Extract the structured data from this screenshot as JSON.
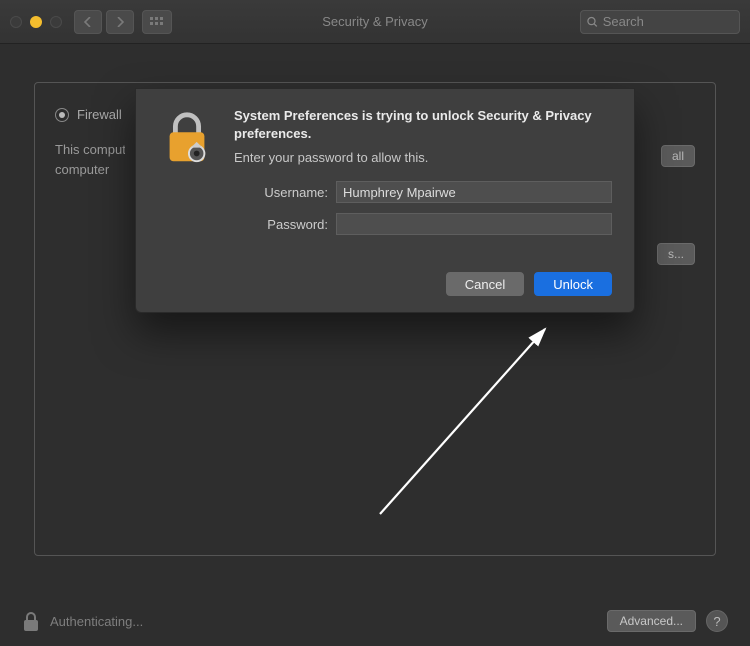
{
  "window": {
    "title": "Security & Privacy",
    "search_placeholder": "Search"
  },
  "tabs": {
    "selected_label": "Firewall"
  },
  "panel": {
    "info_line1": "This computer's firewall is currently turned on.",
    "info_line2": "computer",
    "btn1_label": "all",
    "btn2_label": "s..."
  },
  "dialog": {
    "title": "System Preferences is trying to unlock Security & Privacy preferences.",
    "subtitle": "Enter your password to allow this.",
    "username_label": "Username:",
    "password_label": "Password:",
    "username_value": "Humphrey Mpairwe",
    "password_value": "",
    "cancel_label": "Cancel",
    "unlock_label": "Unlock"
  },
  "footer": {
    "status": "Authenticating...",
    "advanced_label": "Advanced..."
  }
}
